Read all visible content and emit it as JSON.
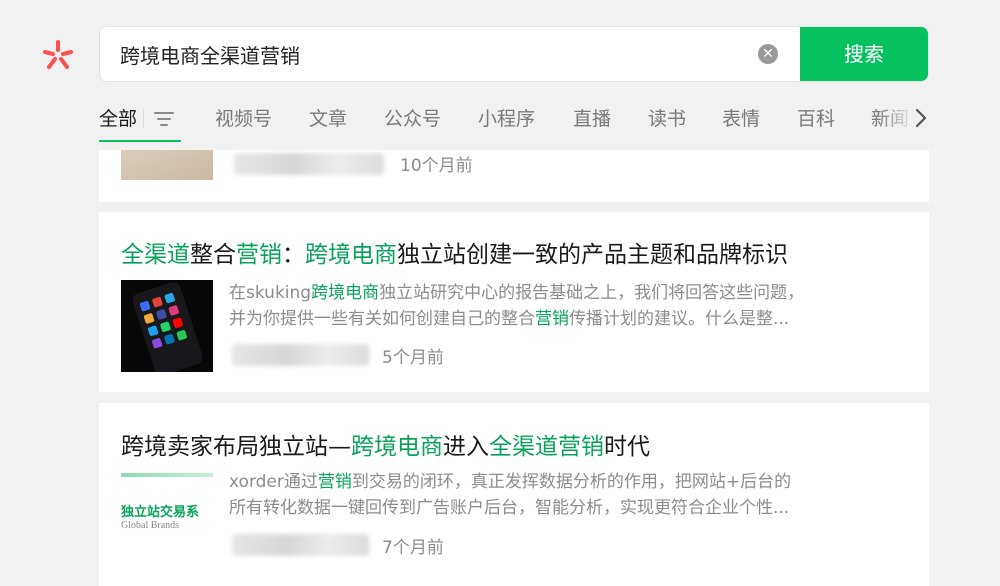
{
  "search": {
    "query": "跨境电商全渠道营销",
    "button_label": "搜索"
  },
  "tabs": [
    {
      "label": "全部",
      "active": true
    },
    {
      "label": "视频号"
    },
    {
      "label": "文章"
    },
    {
      "label": "公众号"
    },
    {
      "label": "小程序"
    },
    {
      "label": "直播"
    },
    {
      "label": "读书"
    },
    {
      "label": "表情"
    },
    {
      "label": "百科"
    },
    {
      "label": "新闻"
    }
  ],
  "results": [
    {
      "time": "10个月前"
    },
    {
      "title_segments": [
        {
          "text": "全渠道",
          "hl": true
        },
        {
          "text": "整合",
          "hl": false
        },
        {
          "text": "营销",
          "hl": true
        },
        {
          "text": "：",
          "hl": false
        },
        {
          "text": "跨境电商",
          "hl": true
        },
        {
          "text": "独立站创建一致的产品主题和品牌标识",
          "hl": false
        }
      ],
      "desc_lines": [
        [
          {
            "text": "在skuking",
            "hl": false
          },
          {
            "text": "跨境电商",
            "hl": true
          },
          {
            "text": "独立站研究中心的报告基础之上，我们将回答这些问题，",
            "hl": false
          }
        ],
        [
          {
            "text": "并为你提供一些有关如何创建自己的整合",
            "hl": false
          },
          {
            "text": "营销",
            "hl": true
          },
          {
            "text": "传播计划的建议。什么是整...",
            "hl": false
          }
        ]
      ],
      "time": "5个月前"
    },
    {
      "title_segments": [
        {
          "text": "跨境卖家布局独立站—",
          "hl": false
        },
        {
          "text": "跨境电商",
          "hl": true
        },
        {
          "text": "进入",
          "hl": false
        },
        {
          "text": "全渠道营销",
          "hl": true
        },
        {
          "text": "时代",
          "hl": false
        }
      ],
      "desc_lines": [
        [
          {
            "text": "xorder通过",
            "hl": false
          },
          {
            "text": "营销",
            "hl": true
          },
          {
            "text": "到交易的闭环，真正发挥数据分析的作用，把网站+后台的",
            "hl": false
          }
        ],
        [
          {
            "text": "所有转化数据一键回传到广告账户后台，智能分析，实现更符合企业个性...",
            "hl": false
          }
        ]
      ],
      "thumb_text": {
        "line1": "独立站交易系",
        "line2": "Global Brands"
      },
      "time": "7个月前"
    }
  ],
  "colors": {
    "accent": "#07c160",
    "highlight": "#07a35a",
    "logo": "#fa5151",
    "background": "#f1f1f1"
  }
}
